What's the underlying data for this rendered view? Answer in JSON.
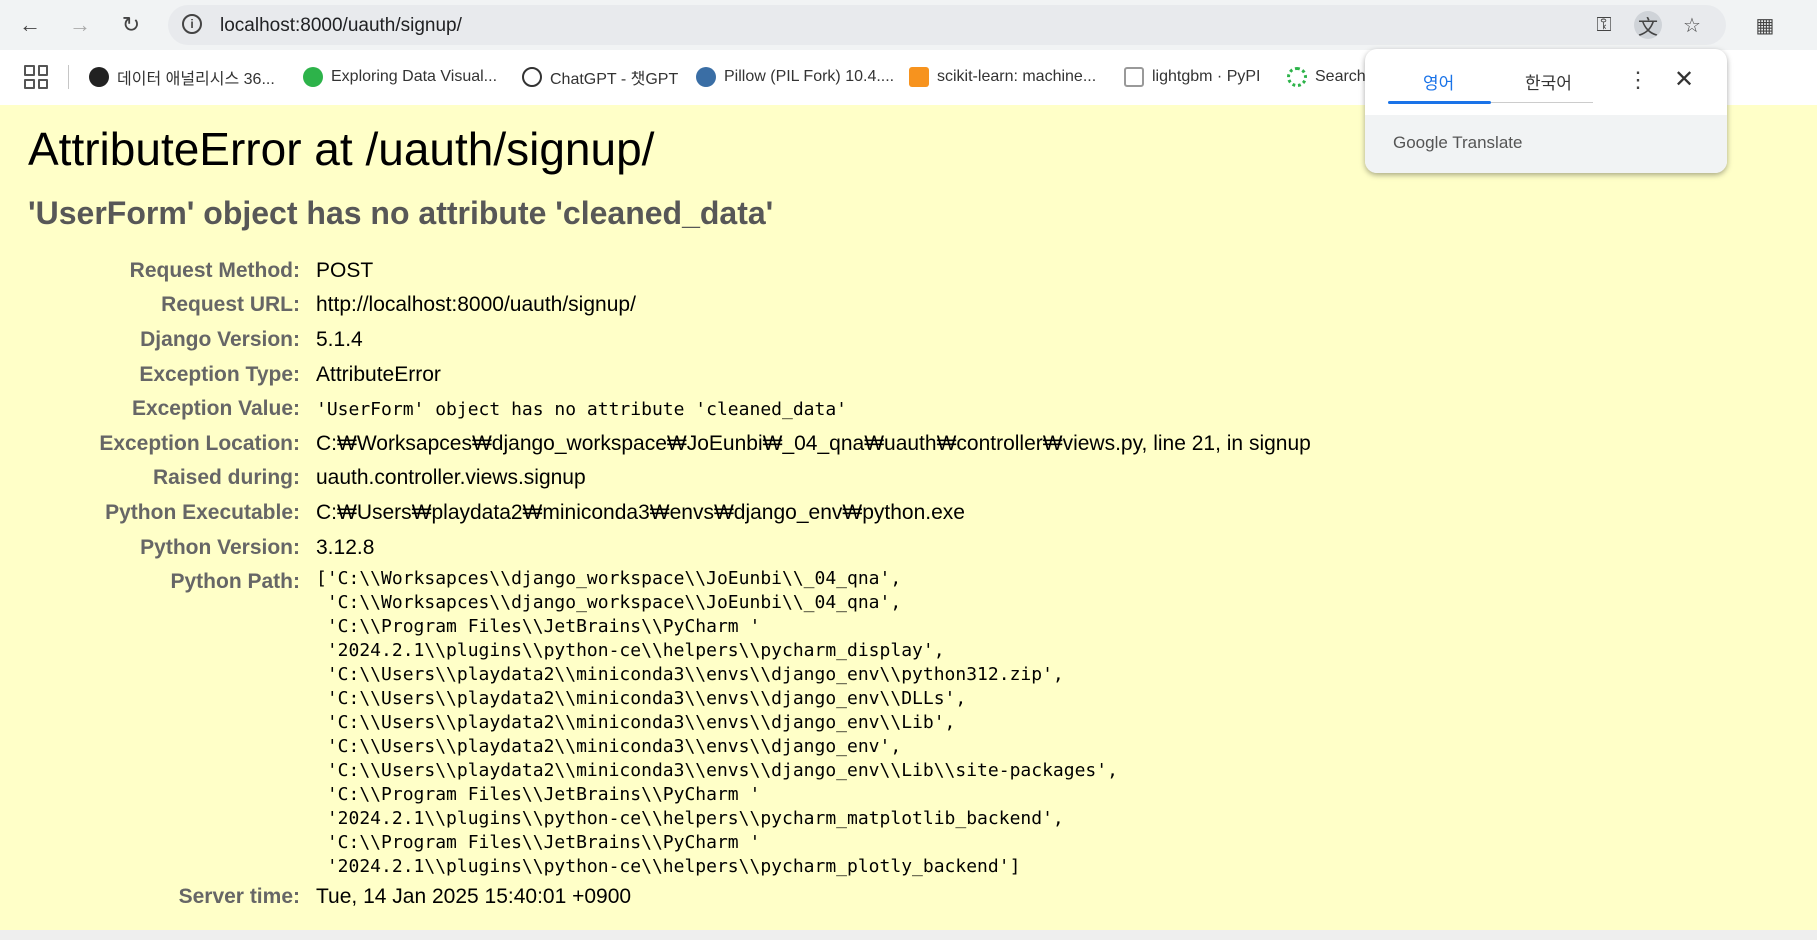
{
  "browser": {
    "url": "localhost:8000/uauth/signup/"
  },
  "bookmarks": [
    {
      "label": "데이터 애널리시스 36...",
      "icon": "github-icon"
    },
    {
      "label": "Exploring Data Visual...",
      "icon": "visualization-icon"
    },
    {
      "label": "ChatGPT - 챗GPT",
      "icon": "chatgpt-icon"
    },
    {
      "label": "Pillow (PIL Fork) 10.4....",
      "icon": "python-icon"
    },
    {
      "label": "scikit-learn: machine...",
      "icon": "chart-icon"
    },
    {
      "label": "lightgbm · PyPI",
      "icon": "package-icon"
    },
    {
      "label": "Search",
      "icon": "search-spinner-icon"
    }
  ],
  "translate_popup": {
    "tab_source": "영어",
    "tab_target": "한국어",
    "brand": "Google Translate"
  },
  "error": {
    "title": "AttributeError at /uauth/signup/",
    "subtitle": "'UserForm' object has no attribute 'cleaned_data'"
  },
  "meta": {
    "request_method": {
      "label": "Request Method:",
      "value": "POST"
    },
    "request_url": {
      "label": "Request URL:",
      "value": "http://localhost:8000/uauth/signup/"
    },
    "django_version": {
      "label": "Django Version:",
      "value": "5.1.4"
    },
    "exception_type": {
      "label": "Exception Type:",
      "value": "AttributeError"
    },
    "exception_value": {
      "label": "Exception Value:",
      "value": "'UserForm' object has no attribute 'cleaned_data'"
    },
    "exception_location": {
      "label": "Exception Location:",
      "value": "C:₩Worksapces₩django_workspace₩JoEunbi₩_04_qna₩uauth₩controller₩views.py, line 21, in signup"
    },
    "raised_during": {
      "label": "Raised during:",
      "value": "uauth.controller.views.signup"
    },
    "python_executable": {
      "label": "Python Executable:",
      "value": "C:₩Users₩playdata2₩miniconda3₩envs₩django_env₩python.exe"
    },
    "python_version": {
      "label": "Python Version:",
      "value": "3.12.8"
    },
    "python_path": {
      "label": "Python Path:",
      "value": "['C:\\\\Worksapces\\\\django_workspace\\\\JoEunbi\\\\_04_qna',\n 'C:\\\\Worksapces\\\\django_workspace\\\\JoEunbi\\\\_04_qna',\n 'C:\\\\Program Files\\\\JetBrains\\\\PyCharm '\n '2024.2.1\\\\plugins\\\\python-ce\\\\helpers\\\\pycharm_display',\n 'C:\\\\Users\\\\playdata2\\\\miniconda3\\\\envs\\\\django_env\\\\python312.zip',\n 'C:\\\\Users\\\\playdata2\\\\miniconda3\\\\envs\\\\django_env\\\\DLLs',\n 'C:\\\\Users\\\\playdata2\\\\miniconda3\\\\envs\\\\django_env\\\\Lib',\n 'C:\\\\Users\\\\playdata2\\\\miniconda3\\\\envs\\\\django_env',\n 'C:\\\\Users\\\\playdata2\\\\miniconda3\\\\envs\\\\django_env\\\\Lib\\\\site-packages',\n 'C:\\\\Program Files\\\\JetBrains\\\\PyCharm '\n '2024.2.1\\\\plugins\\\\python-ce\\\\helpers\\\\pycharm_matplotlib_backend',\n 'C:\\\\Program Files\\\\JetBrains\\\\PyCharm '\n '2024.2.1\\\\plugins\\\\python-ce\\\\helpers\\\\pycharm_plotly_backend']"
    },
    "server_time": {
      "label": "Server time:",
      "value": "Tue, 14 Jan 2025 15:40:01 +0900"
    }
  }
}
